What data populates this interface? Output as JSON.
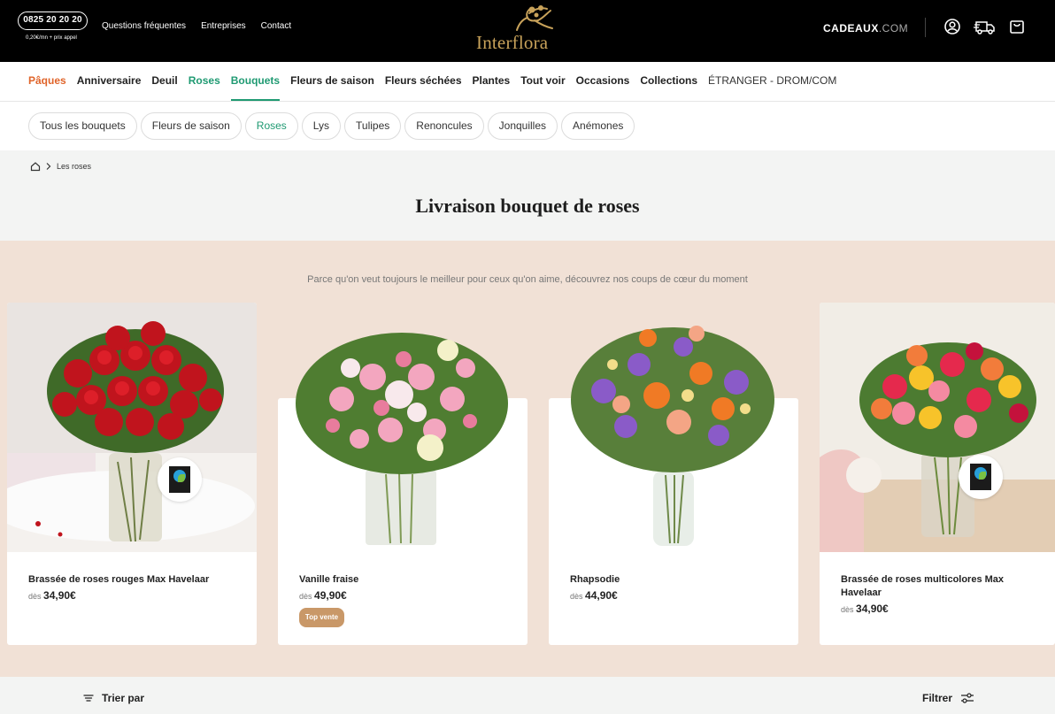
{
  "topbar": {
    "phone": "0825 20 20 20",
    "phone_note": "0,20€/mn + prix appel",
    "links": [
      "Questions fréquentes",
      "Entreprises",
      "Contact"
    ],
    "logo": "Interflora",
    "cadeaux_main": "CADEAUX",
    "cadeaux_tld": ".COM",
    "icons": [
      "account-icon",
      "delivery-truck-icon",
      "shopping-bag-icon"
    ]
  },
  "mainnav": {
    "items": [
      "Pâques",
      "Anniversaire",
      "Deuil",
      "Roses",
      "Bouquets",
      "Fleurs de saison",
      "Fleurs séchées",
      "Plantes",
      "Tout voir",
      "Occasions",
      "Collections",
      "ÉTRANGER - DROM/COM"
    ]
  },
  "subnav": {
    "pills": [
      "Tous les bouquets",
      "Fleurs de saison",
      "Roses",
      "Lys",
      "Tulipes",
      "Renoncules",
      "Jonquilles",
      "Anémones"
    ]
  },
  "breadcrumb": {
    "current": "Les roses"
  },
  "page": {
    "title": "Livraison bouquet de roses"
  },
  "featured": {
    "tagline": "Parce qu'on veut toujours le meilleur pour ceux qu'on aime, découvrez nos coups de cœur du moment",
    "products": [
      {
        "title": "Brassée de roses rouges Max Havelaar",
        "from": "dès",
        "price": "34,90€"
      },
      {
        "title": "Vanille fraise",
        "from": "dès",
        "price": "49,90€",
        "badge": "Top vente"
      },
      {
        "title": "Rhapsodie",
        "from": "dès",
        "price": "44,90€"
      },
      {
        "title": "Brassée de roses multicolores Max Havelaar",
        "from": "dès",
        "price": "34,90€"
      }
    ]
  },
  "sortbar": {
    "sort_label": "Trier par",
    "filter_label": "Filtrer"
  },
  "colors": {
    "accent_green": "#1f9a72",
    "accent_orange": "#e0642a",
    "gold": "#c8a25a",
    "section_bg": "#f1e1d6",
    "badge": "#c99868"
  }
}
